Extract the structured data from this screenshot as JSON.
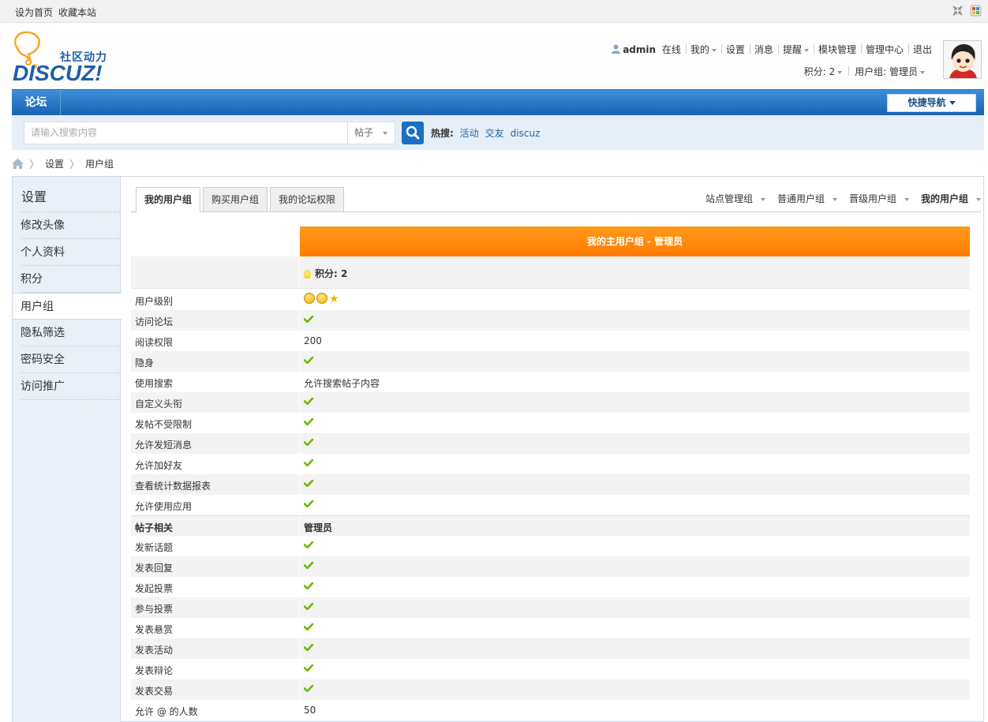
{
  "topbar": {
    "set_home": "设为首页",
    "bookmark": "收藏本站"
  },
  "brand": {
    "slogan": "社区动力",
    "logo_text": "DISCUZ!"
  },
  "user": {
    "name": "admin",
    "status": "在线",
    "my": "我的",
    "settings": "设置",
    "messages": "消息",
    "remind": "提醒",
    "module_mgmt": "模块管理",
    "admin_center": "管理中心",
    "logout": "退出",
    "credits": "积分: 2",
    "group": "用户组: 管理员"
  },
  "nav": {
    "forum": "论坛",
    "quick_nav": "快捷导航"
  },
  "search": {
    "placeholder": "请输入搜索内容",
    "type": "帖子",
    "hot_label": "热搜:",
    "hot": [
      "活动",
      "交友",
      "discuz"
    ]
  },
  "breadcrumb": {
    "items": [
      "设置",
      "用户组"
    ]
  },
  "sidebar": {
    "title": "设置",
    "items": [
      {
        "label": "修改头像"
      },
      {
        "label": "个人资料"
      },
      {
        "label": "积分"
      },
      {
        "label": "用户组"
      },
      {
        "label": "隐私筛选"
      },
      {
        "label": "密码安全"
      },
      {
        "label": "访问推广"
      }
    ],
    "active_index": 3
  },
  "tabs": {
    "left": [
      "我的用户组",
      "购买用户组",
      "我的论坛权限"
    ],
    "right": [
      "站点管理组",
      "普通用户组",
      "晋级用户组",
      "我的用户组"
    ]
  },
  "group_panel": {
    "header": "我的主用户组 - 管理员",
    "credits": "积分: 2",
    "rows": [
      {
        "label": "用户级别",
        "value": "",
        "type": "level"
      },
      {
        "label": "访问论坛",
        "value": "",
        "type": "check"
      },
      {
        "label": "阅读权限",
        "value": "200",
        "type": "text"
      },
      {
        "label": "隐身",
        "value": "",
        "type": "check"
      },
      {
        "label": "使用搜索",
        "value": "允许搜索帖子内容",
        "type": "text"
      },
      {
        "label": "自定义头衔",
        "value": "",
        "type": "check"
      },
      {
        "label": "发帖不受限制",
        "value": "",
        "type": "check"
      },
      {
        "label": "允许发短消息",
        "value": "",
        "type": "check"
      },
      {
        "label": "允许加好友",
        "value": "",
        "type": "check"
      },
      {
        "label": "查看统计数据报表",
        "value": "",
        "type": "check"
      },
      {
        "label": "允许使用应用",
        "value": "",
        "type": "check"
      },
      {
        "label": "帖子相关",
        "value": "管理员",
        "type": "head"
      },
      {
        "label": "发新话题",
        "value": "",
        "type": "check"
      },
      {
        "label": "发表回复",
        "value": "",
        "type": "check"
      },
      {
        "label": "发起投票",
        "value": "",
        "type": "check"
      },
      {
        "label": "参与投票",
        "value": "",
        "type": "check"
      },
      {
        "label": "发表悬赏",
        "value": "",
        "type": "check"
      },
      {
        "label": "发表活动",
        "value": "",
        "type": "check"
      },
      {
        "label": "发表辩论",
        "value": "",
        "type": "check"
      },
      {
        "label": "发表交易",
        "value": "",
        "type": "check"
      },
      {
        "label": "允许 @ 的人数",
        "value": "50",
        "type": "text"
      }
    ]
  },
  "colors": {
    "nav_blue": "#1a62b0",
    "accent_orange": "#ff7b00",
    "check_green": "#6cb800",
    "link_blue": "#2467aa"
  }
}
